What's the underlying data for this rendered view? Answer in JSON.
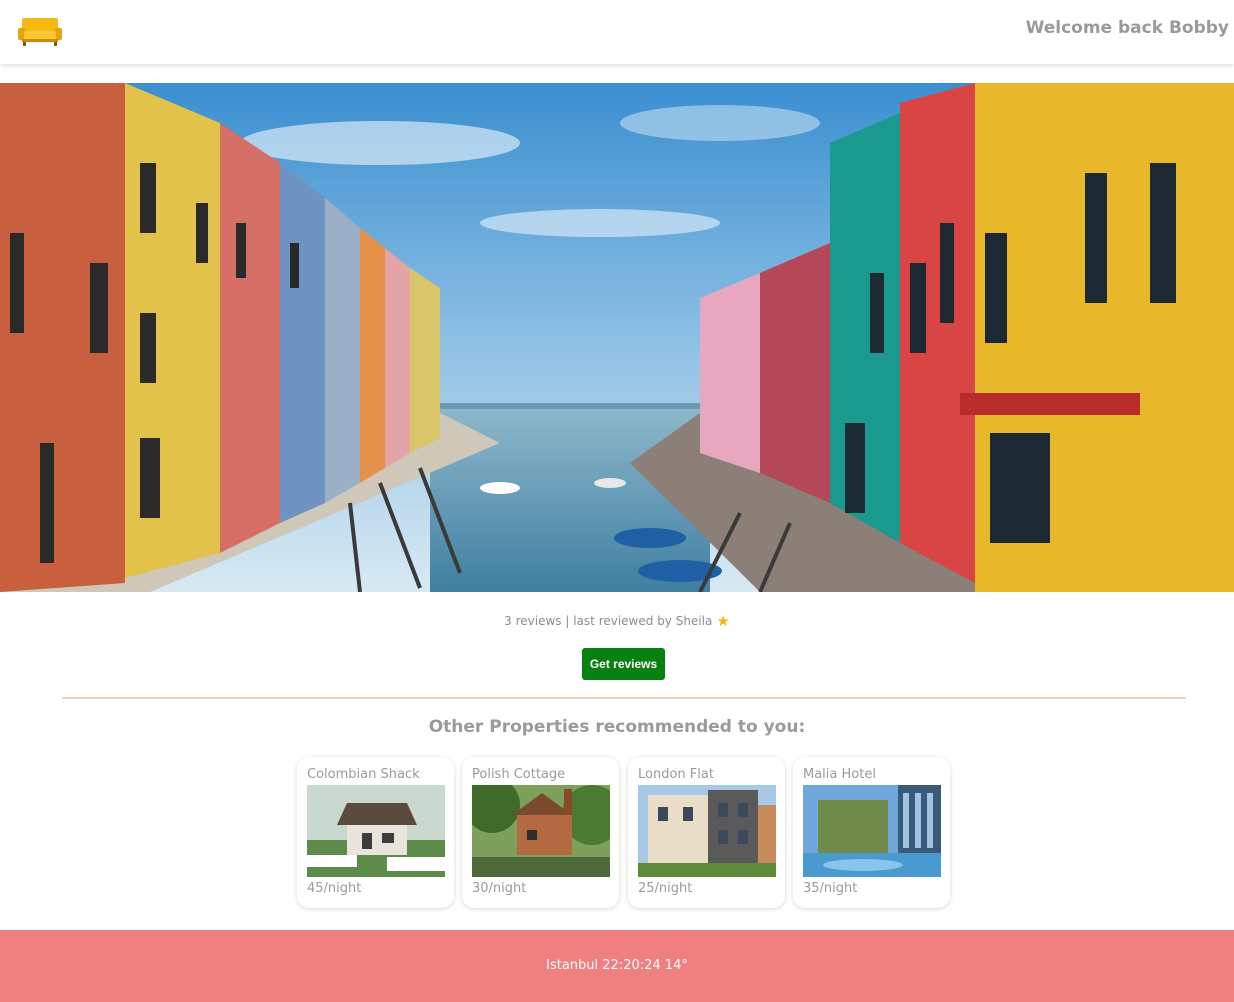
{
  "header": {
    "logo_icon": "sofa-icon",
    "welcome_text": "Welcome back Bobby"
  },
  "hero": {
    "image_icon": "canal-street-photo"
  },
  "reviews": {
    "summary_text": "3 reviews | last reviewed by Sheila",
    "star_icon": "star-icon",
    "button_label": "Get reviews"
  },
  "recommended": {
    "title": "Other Properties recommended to you:",
    "properties": [
      {
        "name": "Colombian Shack",
        "price": "45/night",
        "image_icon": "cottage-photo"
      },
      {
        "name": "Polish Cottage",
        "price": "30/night",
        "image_icon": "brick-cottage-photo"
      },
      {
        "name": "London Flat",
        "price": "25/night",
        "image_icon": "townhouse-photo"
      },
      {
        "name": "Malia Hotel",
        "price": "35/night",
        "image_icon": "hotel-photo"
      }
    ]
  },
  "footer": {
    "text": "Istanbul 22:20:24 14°"
  },
  "colors": {
    "accent_green": "#0a7f12",
    "footer_bg": "#f07f7f",
    "text_gray": "#9a9a9a"
  }
}
